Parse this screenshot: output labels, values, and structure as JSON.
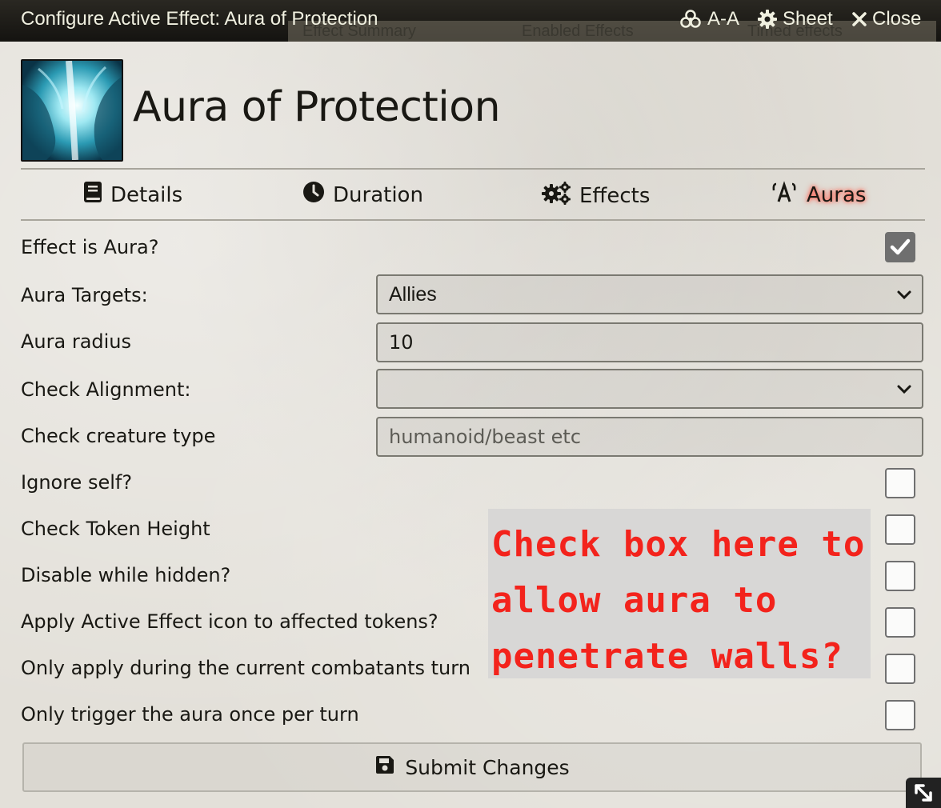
{
  "window": {
    "title": "Configure Active Effect: Aura of Protection",
    "buttons": {
      "aa": "A-A",
      "sheet": "Sheet",
      "close": "Close"
    },
    "background_text": [
      "Effect Summary",
      "Enabled Effects",
      "Timed effects"
    ]
  },
  "effect": {
    "name": "Aura of Protection"
  },
  "tabs": [
    {
      "label": "Details",
      "icon": "book-icon"
    },
    {
      "label": "Duration",
      "icon": "clock-icon"
    },
    {
      "label": "Effects",
      "icon": "gears-icon"
    },
    {
      "label": "Auras",
      "icon": "aura-icon",
      "active": true
    }
  ],
  "form": {
    "effect_is_aura": {
      "label": "Effect is Aura?",
      "checked": true
    },
    "aura_targets": {
      "label": "Aura Targets:",
      "value": "Allies"
    },
    "aura_radius": {
      "label": "Aura radius",
      "value": "10"
    },
    "check_alignment": {
      "label": "Check Alignment:",
      "value": ""
    },
    "check_creature_type": {
      "label": "Check creature type",
      "placeholder": "humanoid/beast etc"
    },
    "ignore_self": {
      "label": "Ignore self?",
      "checked": false
    },
    "check_token_height": {
      "label": "Check Token Height",
      "checked": false
    },
    "disable_while_hidden": {
      "label": "Disable while hidden?",
      "checked": false
    },
    "apply_icon": {
      "label": "Apply Active Effect icon to affected tokens?",
      "checked": false
    },
    "only_combatant_turn": {
      "label": "Only apply during the current combatants turn",
      "checked": false
    },
    "once_per_turn": {
      "label": "Only trigger the aura once per turn",
      "checked": false
    }
  },
  "annotation": {
    "lines": [
      "Check box here to",
      "allow aura to",
      "penetrate walls?"
    ],
    "color": "#f3231c"
  },
  "submit": {
    "label": "Submit Changes"
  }
}
